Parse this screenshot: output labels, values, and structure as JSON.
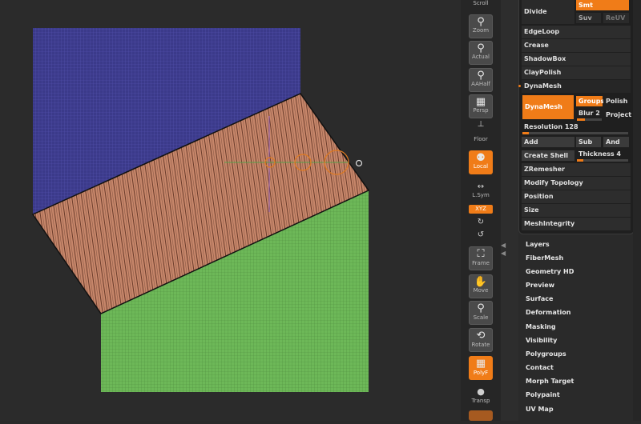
{
  "toolbar": {
    "scroll": "Scroll",
    "zoom": "Zoom",
    "actual": "Actual",
    "aahalf": "AAHalf",
    "persp": "Persp",
    "floor": "Floor",
    "local": "Local",
    "lsym": "L.Sym",
    "xyz": "XYZ",
    "frame": "Frame",
    "move": "Move",
    "scale": "Scale",
    "rotate": "Rotate",
    "polyf": "PolyF",
    "transp": "Transp"
  },
  "geometry_panel": {
    "divide": "Divide",
    "smt": "Smt",
    "suv": "Suv",
    "reuv": "ReUV",
    "edgeloop": "EdgeLoop",
    "crease": "Crease",
    "shadowbox": "ShadowBox",
    "claypolish": "ClayPolish",
    "dynamesh_header": "DynaMesh",
    "dynamesh_btn": "DynaMesh",
    "groups": "Groups",
    "polish": "Polish",
    "blur": "Blur 2",
    "project": "Project",
    "resolution": "Resolution 128",
    "add": "Add",
    "sub": "Sub",
    "and": "And",
    "create_shell": "Create Shell",
    "thickness": "Thickness 4",
    "zremesher": "ZRemesher",
    "modify_topology": "Modify Topology",
    "position": "Position",
    "size": "Size",
    "meshintegrity": "MeshIntegrity"
  },
  "tool_menu": [
    "Layers",
    "FiberMesh",
    "Geometry HD",
    "Preview",
    "Surface",
    "Deformation",
    "Masking",
    "Visibility",
    "Polygroups",
    "Contact",
    "Morph Target",
    "Polypaint",
    "UV Map"
  ],
  "colors": {
    "accent": "#f07c18",
    "blue_mesh": "#3c3a8c",
    "copper_mesh": "#c98a6c",
    "green_mesh": "#6fbf5a"
  }
}
